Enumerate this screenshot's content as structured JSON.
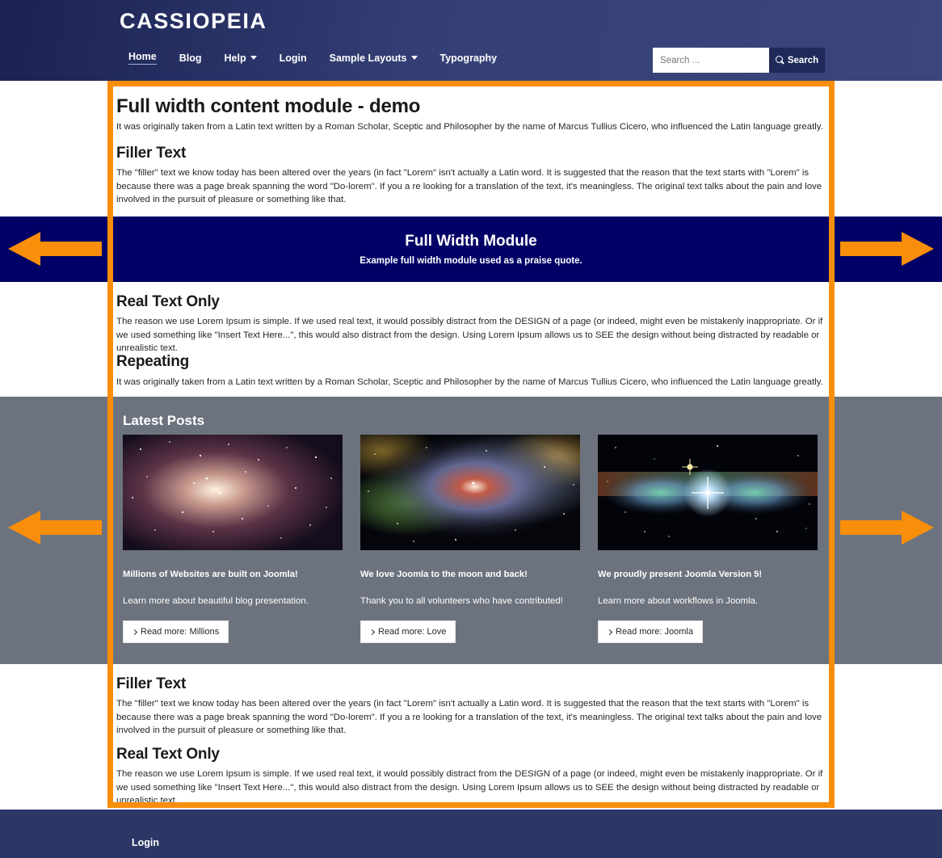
{
  "header": {
    "brand": "CASSIOPEIA",
    "nav": [
      {
        "label": "Home",
        "has_caret": false,
        "active": true
      },
      {
        "label": "Blog",
        "has_caret": false,
        "active": false
      },
      {
        "label": "Help",
        "has_caret": true,
        "active": false
      },
      {
        "label": "Login",
        "has_caret": false,
        "active": false
      },
      {
        "label": "Sample Layouts",
        "has_caret": true,
        "active": false
      },
      {
        "label": "Typography",
        "has_caret": false,
        "active": false
      }
    ],
    "search": {
      "placeholder": "Search ...",
      "value": "",
      "button_label": "Search"
    }
  },
  "main": {
    "page_title": "Full width content module - demo",
    "intro": "It was originally taken from a Latin text written by a Roman Scholar, Sceptic and Philosopher by the name of Marcus Tullius Cicero, who influenced the Latin language greatly.",
    "filler_heading": "Filler Text",
    "filler_body": "The \"filler\" text we know today has been altered over the years (in fact \"Lorem\" isn't actually a Latin word. It is suggested that the reason that the text starts with \"Lorem\" is because there was a page break spanning the word \"Do-lorem\". If you a re looking for a translation of the text, it's meaningless. The original text talks about the pain and love involved in the pursuit of pleasure or something like that.",
    "real_text_heading": "Real Text Only",
    "real_text_body": "The reason we use Lorem Ipsum is simple. If we used real text, it would possibly distract from the DESIGN of a page (or indeed, might even be mistakenly inappropriate. Or if we used something like \"Insert Text Here...\", this would also distract from the design. Using Lorem Ipsum allows us to SEE the design without being distracted by readable or unrealistic text.",
    "repeating_heading": "Repeating",
    "repeating_body": "It was originally taken from a Latin text written by a Roman Scholar, Sceptic and Philosopher by the name of Marcus Tullius Cicero, who influenced the Latin language greatly.",
    "filler_heading_2": "Filler Text",
    "filler_body_2": "The \"filler\" text we know today has been altered over the years (in fact \"Lorem\" isn't actually a Latin word. It is suggested that the reason that the text starts with \"Lorem\" is because there was a page break spanning the word \"Do-lorem\". If you a re looking for a translation of the text, it's meaningless. The original text talks about the pain and love involved in the pursuit of pleasure or something like that.",
    "real_text_heading_2": "Real Text Only",
    "real_text_body_2": "The reason we use Lorem Ipsum is simple. If we used real text, it would possibly distract from the DESIGN of a page (or indeed, might even be mistakenly inappropriate. Or if we used something like \"Insert Text Here...\", this would also distract from the design. Using Lorem Ipsum allows us to SEE the design without being distracted by readable or unrealistic text."
  },
  "full_width_module": {
    "title": "Full Width Module",
    "subtitle": "Example full width module used as a praise quote.",
    "background_color": "#000066"
  },
  "latest_posts": {
    "title": "Latest Posts",
    "background_color": "#6c737e",
    "cards": [
      {
        "image_alt": "nebula-pink-starfield",
        "title": "Millions of Websites are built on Joomla!",
        "description": "Learn more about beautiful blog presentation.",
        "button_label": "Read more: Millions"
      },
      {
        "image_alt": "nebula-green-blue-cloud",
        "title": "We love Joomla to the moon and back!",
        "description": "Thank you to all volunteers who have contributed!",
        "button_label": "Read more: Love"
      },
      {
        "image_alt": "butterfly-nebula-twin-jet",
        "title": "We proudly present Joomla Version 5!",
        "description": "Learn more about workflows in Joomla.",
        "button_label": "Read more: Joomla"
      }
    ]
  },
  "footer": {
    "login_label": "Login",
    "background_color": "#2c3766"
  },
  "annotations": {
    "highlight_color": "#f98e0a",
    "arrows": [
      {
        "name": "arrow-left-upper",
        "direction": "left"
      },
      {
        "name": "arrow-right-upper",
        "direction": "right"
      },
      {
        "name": "arrow-left-lower",
        "direction": "left"
      },
      {
        "name": "arrow-right-lower",
        "direction": "right"
      }
    ]
  }
}
